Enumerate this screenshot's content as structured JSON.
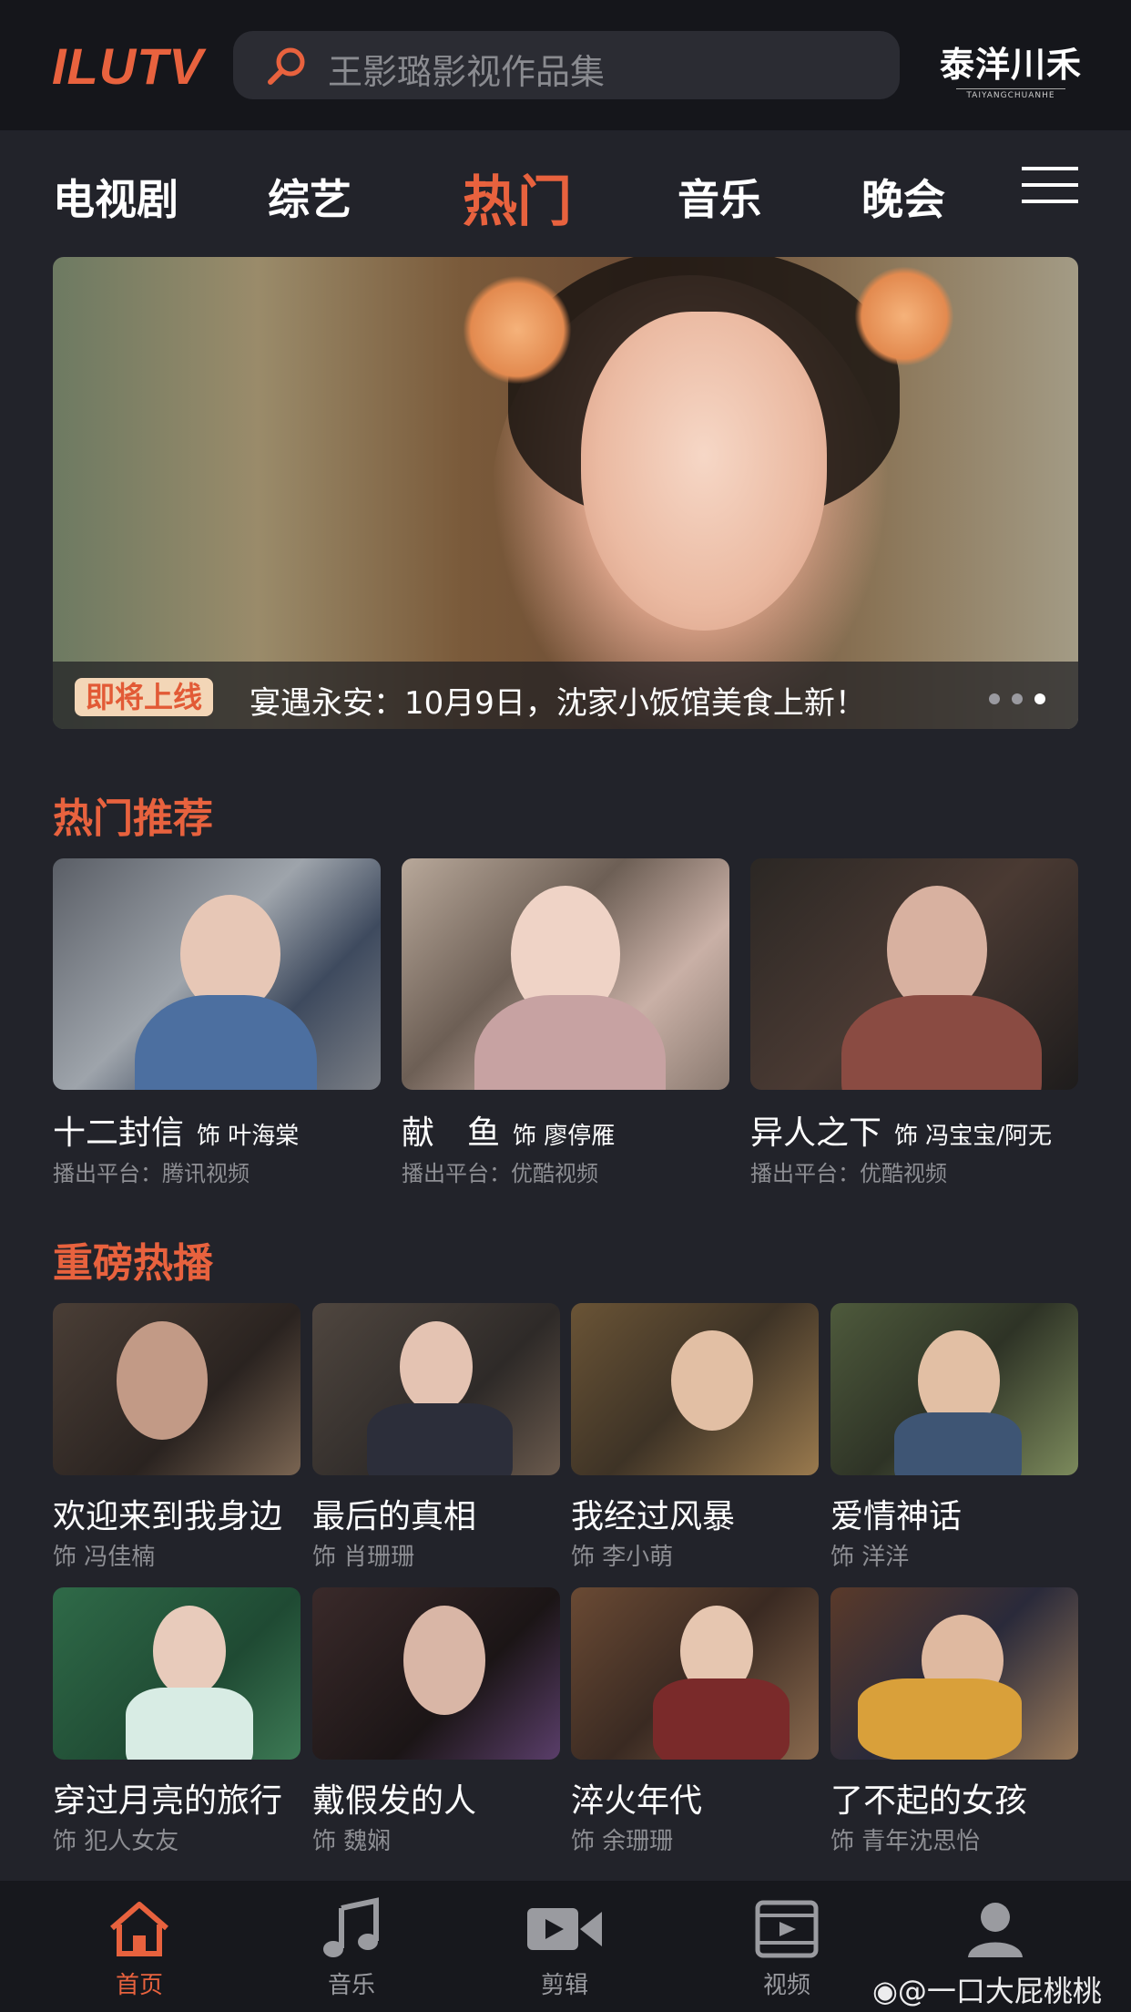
{
  "header": {
    "logo": "ILUTV",
    "search_placeholder": "王影璐影视作品集",
    "brand_name": "泰洋川禾",
    "brand_sub": "TAIYANGCHUANHE"
  },
  "tabs": [
    {
      "label": "电视剧"
    },
    {
      "label": "综艺"
    },
    {
      "label": "热门",
      "active": true
    },
    {
      "label": "音乐"
    },
    {
      "label": "晚会"
    }
  ],
  "banner": {
    "badge": "即将上线",
    "caption": "宴遇永安：10月9日，沈家小饭馆美食上新！",
    "dots": 3,
    "active_dot": 3
  },
  "hot_recommend": {
    "title": "热门推荐",
    "items": [
      {
        "title": "十二封信",
        "role": "饰 叶海棠",
        "platform": "播出平台：腾讯视频"
      },
      {
        "title": "献　鱼",
        "role": "饰 廖停雁",
        "platform": "播出平台：优酷视频"
      },
      {
        "title": "异人之下",
        "role": "饰 冯宝宝/阿无",
        "platform": "播出平台：优酷视频"
      }
    ]
  },
  "heavy_hits": {
    "title": "重磅热播",
    "items": [
      {
        "title": "欢迎来到我身边",
        "role": "饰 冯佳楠"
      },
      {
        "title": "最后的真相",
        "role": "饰 肖珊珊"
      },
      {
        "title": "我经过风暴",
        "role": "饰 李小萌"
      },
      {
        "title": "爱情神话",
        "role": "饰 洋洋"
      },
      {
        "title": "穿过月亮的旅行",
        "role": "饰 犯人女友"
      },
      {
        "title": "戴假发的人",
        "role": "饰 魏娴"
      },
      {
        "title": "淬火年代",
        "role": "饰 余珊珊"
      },
      {
        "title": "了不起的女孩",
        "role": "饰 青年沈思怡"
      }
    ]
  },
  "bottom_nav": [
    {
      "label": "首页",
      "icon": "home-icon",
      "active": true
    },
    {
      "label": "音乐",
      "icon": "music-icon"
    },
    {
      "label": "剪辑",
      "icon": "video-camera-icon"
    },
    {
      "label": "视频",
      "icon": "film-icon"
    },
    {
      "label": "",
      "icon": "user-icon"
    }
  ],
  "watermark": "@一口大屁桃桃",
  "colors": {
    "accent": "#e8623e",
    "background": "#22232a",
    "header_bg": "#15161b"
  }
}
